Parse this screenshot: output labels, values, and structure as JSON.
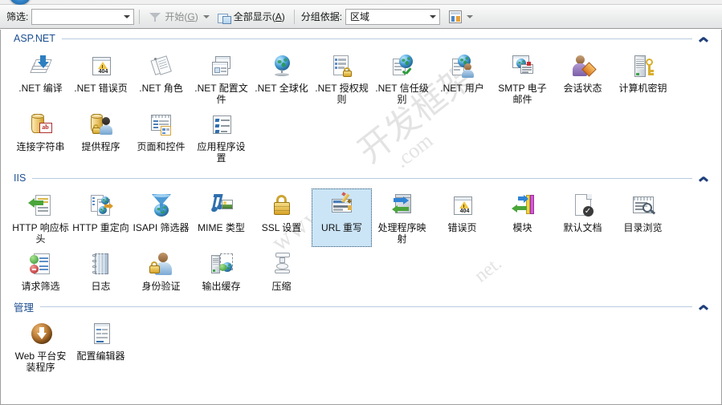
{
  "window": {
    "orb_icon": "windows-orb-icon"
  },
  "toolbar": {
    "filter_label": "筛选:",
    "filter_value": "",
    "filter_placeholder": "",
    "start_button": {
      "label_prefix": "开始(",
      "accel": "G",
      "label_suffix": ")",
      "icon": "funnel-icon",
      "enabled": false
    },
    "show_all_button": {
      "label_prefix": "全部显示(",
      "accel": "A",
      "label_suffix": ")",
      "icon": "show-all-icon"
    },
    "group_by_label": "分组依据:",
    "group_by_value": "区域",
    "view_button_icon": "view-grid-icon"
  },
  "watermark": {
    "l1": "开发框架",
    "l2": "www.",
    "l3": ".com",
    "l4": "net."
  },
  "sections": [
    {
      "id": "aspnet",
      "title": "ASP.NET",
      "collapse_icon": "chevron-up-icon",
      "items": [
        {
          "label": ".NET 编译",
          "icon": "net-compilation-icon",
          "selected": false
        },
        {
          "label": ".NET 错误页",
          "icon": "net-error-pages-icon",
          "selected": false
        },
        {
          "label": ".NET 角色",
          "icon": "net-roles-icon",
          "selected": false
        },
        {
          "label": ".NET 配置文件",
          "icon": "net-profile-icon",
          "selected": false
        },
        {
          "label": ".NET 全球化",
          "icon": "net-globalization-icon",
          "selected": false
        },
        {
          "label": ".NET 授权规则",
          "icon": "net-auth-rules-icon",
          "selected": false
        },
        {
          "label": ".NET 信任级别",
          "icon": "net-trust-levels-icon",
          "selected": false
        },
        {
          "label": ".NET 用户",
          "icon": "net-users-icon",
          "selected": false
        },
        {
          "label": "SMTP 电子邮件",
          "icon": "smtp-email-icon",
          "selected": false
        },
        {
          "label": "会话状态",
          "icon": "session-state-icon",
          "selected": false
        },
        {
          "label": "计算机密钥",
          "icon": "machine-key-icon",
          "selected": false
        },
        {
          "label": "连接字符串",
          "icon": "connection-strings-icon",
          "selected": false
        },
        {
          "label": "提供程序",
          "icon": "providers-icon",
          "selected": false
        },
        {
          "label": "页面和控件",
          "icon": "pages-and-controls-icon",
          "selected": false
        },
        {
          "label": "应用程序设置",
          "icon": "application-settings-icon",
          "selected": false
        }
      ]
    },
    {
      "id": "iis",
      "title": "IIS",
      "collapse_icon": "chevron-up-icon",
      "items": [
        {
          "label": "HTTP 响应标头",
          "icon": "http-response-headers-icon",
          "selected": false
        },
        {
          "label": "HTTP 重定向",
          "icon": "http-redirect-icon",
          "selected": false
        },
        {
          "label": "ISAPI 筛选器",
          "icon": "isapi-filters-icon",
          "selected": false
        },
        {
          "label": "MIME 类型",
          "icon": "mime-types-icon",
          "selected": false
        },
        {
          "label": "SSL 设置",
          "icon": "ssl-settings-icon",
          "selected": false
        },
        {
          "label": "URL 重写",
          "icon": "url-rewrite-icon",
          "selected": true
        },
        {
          "label": "处理程序映射",
          "icon": "handler-mappings-icon",
          "selected": false
        },
        {
          "label": "错误页",
          "icon": "error-pages-icon",
          "selected": false
        },
        {
          "label": "模块",
          "icon": "modules-icon",
          "selected": false
        },
        {
          "label": "默认文档",
          "icon": "default-document-icon",
          "selected": false
        },
        {
          "label": "目录浏览",
          "icon": "directory-browsing-icon",
          "selected": false
        },
        {
          "label": "请求筛选",
          "icon": "request-filtering-icon",
          "selected": false
        },
        {
          "label": "日志",
          "icon": "logging-icon",
          "selected": false
        },
        {
          "label": "身份验证",
          "icon": "authentication-icon",
          "selected": false
        },
        {
          "label": "输出缓存",
          "icon": "output-caching-icon",
          "selected": false
        },
        {
          "label": "压缩",
          "icon": "compression-icon",
          "selected": false
        }
      ]
    },
    {
      "id": "management",
      "title": "管理",
      "collapse_icon": "chevron-up-icon",
      "items": [
        {
          "label": "Web 平台安装程序",
          "icon": "web-platform-installer-icon",
          "selected": false
        },
        {
          "label": "配置编辑器",
          "icon": "configuration-editor-icon",
          "selected": false
        }
      ]
    }
  ]
}
